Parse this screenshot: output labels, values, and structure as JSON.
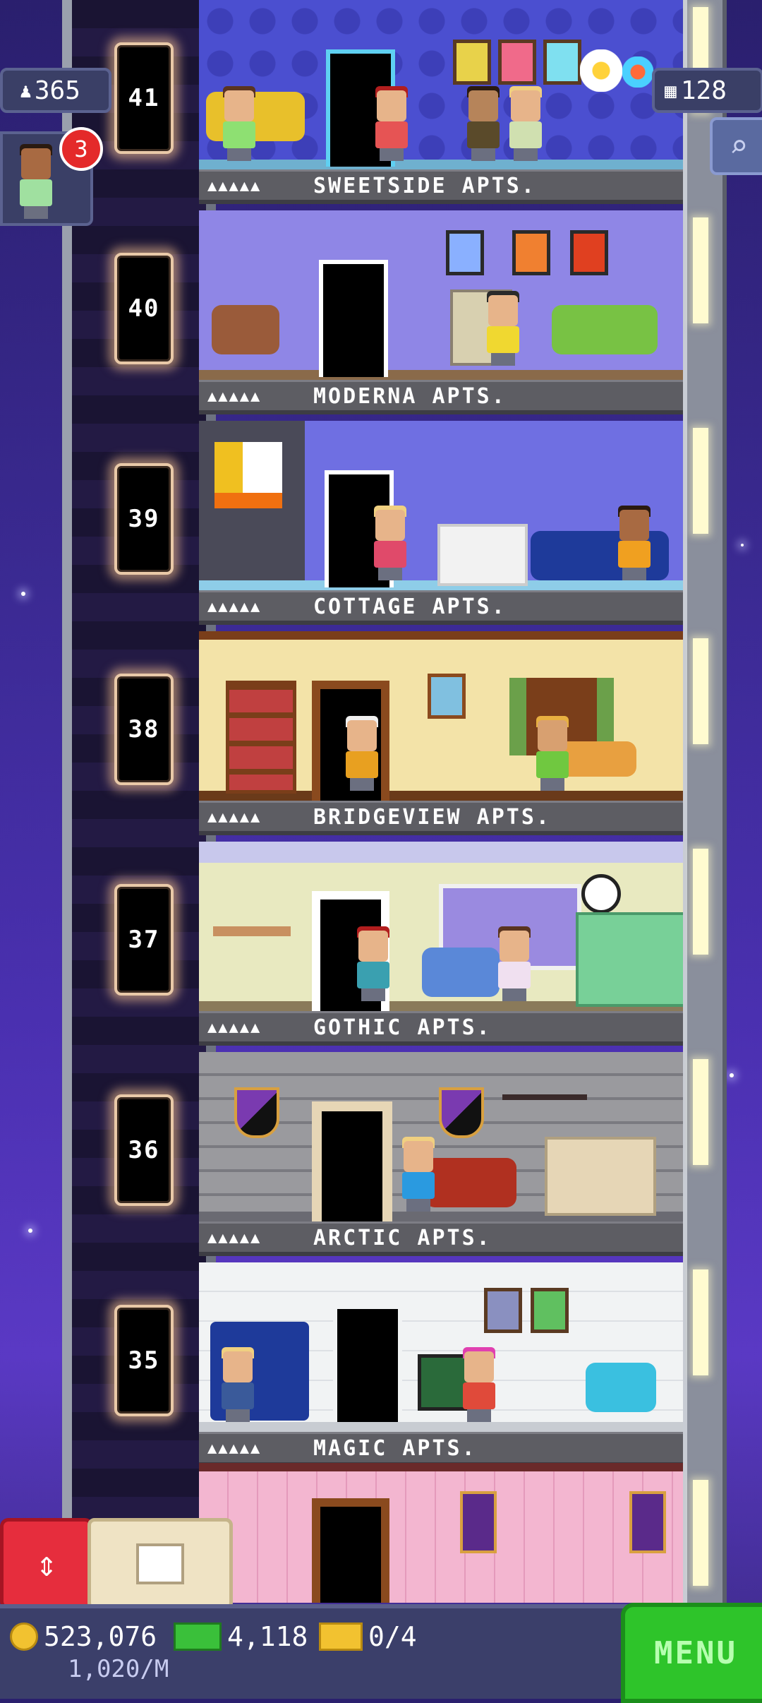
{
  "hud": {
    "population": "365",
    "floors": "128",
    "notification_count": "3"
  },
  "floors": [
    {
      "number": "41",
      "name": "SWEETSIDE APTS.",
      "stars": "▲▲▲▲▲",
      "bg": "#4b4fd0"
    },
    {
      "number": "40",
      "name": "MODERNA APTS.",
      "stars": "▲▲▲▲▲",
      "bg": "#8f86e6"
    },
    {
      "number": "39",
      "name": "COTTAGE APTS.",
      "stars": "▲▲▲▲▲",
      "bg": "#6f6fe2"
    },
    {
      "number": "38",
      "name": "BRIDGEVIEW APTS.",
      "stars": "▲▲▲▲▲",
      "bg": "#f3e3a8"
    },
    {
      "number": "37",
      "name": "GOTHIC APTS.",
      "stars": "▲▲▲▲▲",
      "bg": "#e8e9c0"
    },
    {
      "number": "36",
      "name": "ARCTIC APTS.",
      "stars": "▲▲▲▲▲",
      "bg": "#9a9a9e"
    },
    {
      "number": "35",
      "name": "MAGIC APTS.",
      "stars": "▲▲▲▲▲",
      "bg": "#f1f3f4"
    }
  ],
  "bottom": {
    "coins": "523,076",
    "income": "1,020/M",
    "bux": "4,118",
    "tickets": "0/4",
    "menu_label": "MENU"
  },
  "icons": [
    "person-icon",
    "building-icon",
    "magnify-icon",
    "elevator-arrows-icon",
    "build-box-icon",
    "coin-icon",
    "bux-icon",
    "ticket-icon"
  ]
}
